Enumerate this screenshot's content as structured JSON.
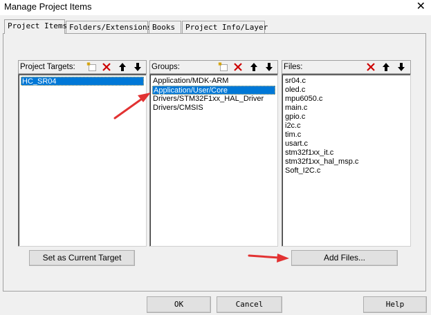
{
  "window": {
    "title": "Manage Project Items",
    "close_glyph": "✕"
  },
  "tabs": [
    {
      "label": "Project Items"
    },
    {
      "label": "Folders/Extensions"
    },
    {
      "label": "Books"
    },
    {
      "label": "Project Info/Layer"
    }
  ],
  "project_targets": {
    "header": "Project Targets:",
    "items": [
      "HC_SR04"
    ],
    "selected_index": 0
  },
  "groups": {
    "header": "Groups:",
    "items": [
      "Application/MDK-ARM",
      "Application/User/Core",
      "Drivers/STM32F1xx_HAL_Driver",
      "Drivers/CMSIS"
    ],
    "selected_index": 1
  },
  "files": {
    "header": "Files:",
    "items": [
      "sr04.c",
      "oled.c",
      "mpu6050.c",
      "main.c",
      "gpio.c",
      "i2c.c",
      "tim.c",
      "usart.c",
      "stm32f1xx_it.c",
      "stm32f1xx_hal_msp.c",
      "Soft_I2C.c"
    ]
  },
  "buttons": {
    "set_current_target": "Set as Current Target",
    "add_files": "Add Files...",
    "ok": "OK",
    "cancel": "Cancel",
    "help": "Help"
  },
  "colors": {
    "selection": "#0078d7",
    "arrow": "#e23232",
    "delete": "#cc0000"
  },
  "icons": [
    "new-item-icon",
    "delete-icon",
    "move-up-icon",
    "move-down-icon",
    "red-arrow-annotation"
  ]
}
